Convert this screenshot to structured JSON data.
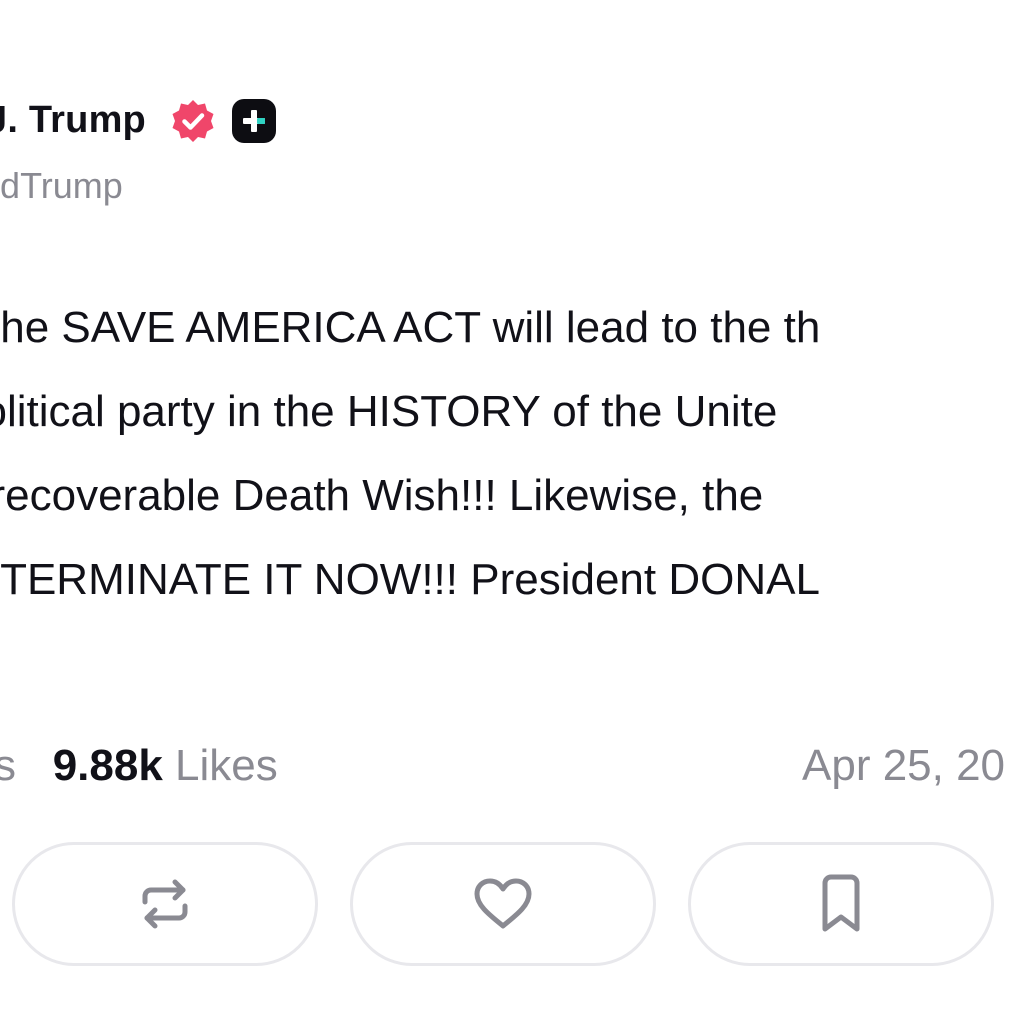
{
  "post": {
    "display_name": "J. Trump",
    "handle": "naldTrump",
    "body_lines": [
      "the SAVE AMERICA ACT will lead to the th",
      "political party in the HISTORY of the Unite",
      "nrecoverable Death Wish!!! Likewise, the",
      "- TERMINATE IT NOW!!! President DONAL"
    ],
    "stats": {
      "reposts_suffix": "s",
      "likes_count": "9.88k",
      "likes_label": "Likes"
    },
    "date": "Apr 25, 20"
  },
  "icons": {
    "verified": "verified-badge-icon",
    "plus": "plus-badge-icon",
    "repost": "repost-icon",
    "like": "heart-icon",
    "bookmark": "bookmark-icon"
  },
  "colors": {
    "verified": "#f0466a",
    "text": "#111118",
    "muted": "#8a8a92",
    "border": "#e8e8ec",
    "plus_cross": "#2fd3c3"
  }
}
